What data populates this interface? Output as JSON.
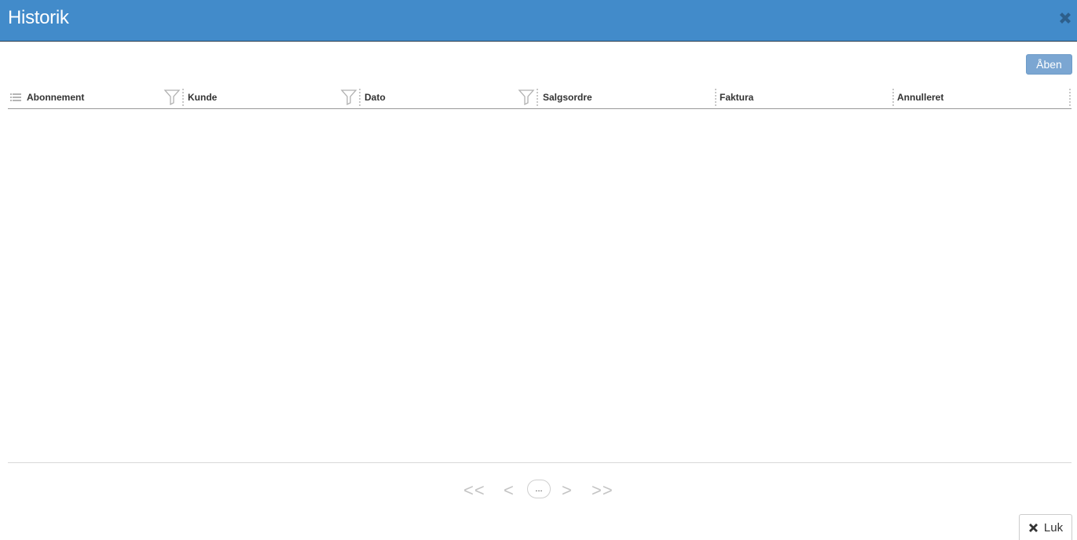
{
  "dialog": {
    "title": "Historik",
    "accent_color": "#428bca"
  },
  "toolbar": {
    "open_label": "Åben"
  },
  "grid": {
    "columns": [
      {
        "label": "Abonnement",
        "filterable": true
      },
      {
        "label": "Kunde",
        "filterable": true
      },
      {
        "label": "Dato",
        "filterable": true
      },
      {
        "label": "Salgsordre",
        "filterable": false
      },
      {
        "label": "Faktura",
        "filterable": false
      },
      {
        "label": "Annulleret",
        "filterable": false
      }
    ],
    "rows": []
  },
  "pager": {
    "first": "<<",
    "prev": "<",
    "current": "...",
    "next": ">",
    "last": ">>"
  },
  "footer": {
    "close_label": "Luk"
  }
}
